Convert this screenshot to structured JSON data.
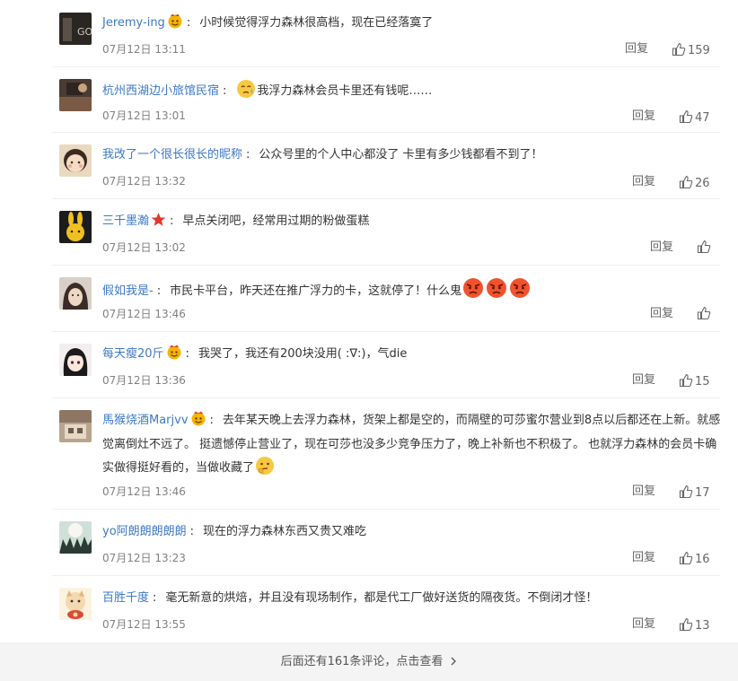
{
  "comments": [
    {
      "username": "Jeremy-ing",
      "text": "小时候觉得浮力森林很高档，现在已经落寞了",
      "date": "07月12日 13:11",
      "reply_label": "回复",
      "likes": "159",
      "badge": "crown-emoji-icon"
    },
    {
      "username": "杭州西湖边小旅馆民宿",
      "text": "我浮力森林会员卡里还有钱呢……",
      "date": "07月12日 13:01",
      "reply_label": "回复",
      "likes": "47",
      "lead_emoji": "crying-face-icon"
    },
    {
      "username": "我改了一个很长很长的昵称",
      "text": "公众号里的个人中心都没了 卡里有多少钱都看不到了！",
      "date": "07月12日 13:32",
      "reply_label": "回复",
      "likes": "26"
    },
    {
      "username": "三千墨瀚",
      "text": "早点关闭吧，经常用过期的粉做蛋糕",
      "date": "07月12日 13:02",
      "reply_label": "回复",
      "likes": "",
      "badge": "red-star-icon"
    },
    {
      "username": "假如我是-",
      "text": "市民卡平台，昨天还在推广浮力的卡，这就停了！什么鬼",
      "date": "07月12日 13:46",
      "reply_label": "回复",
      "likes": "",
      "trail_emoji": "angry-face-icon"
    },
    {
      "username": "每天瘦20斤",
      "text": "我哭了，我还有200块没用( :∇:)，气die",
      "date": "07月12日 13:36",
      "reply_label": "回复",
      "likes": "15",
      "badge": "crown-emoji-icon"
    },
    {
      "username": "馬猴烧酒Marjvv",
      "text": "去年某天晚上去浮力森林，货架上都是空的，而隔壁的可莎蜜尔营业到8点以后都还在上新。就感觉离倒灶不远了。 挺遗憾停止营业了，现在可莎也没多少竞争压力了，晚上补新也不积极了。 也就浮力森林的会员卡确实做得挺好看的，当做收藏了",
      "date": "07月12日 13:46",
      "reply_label": "回复",
      "likes": "17",
      "badge": "crown-emoji-icon",
      "trail_emoji": "thinking-face-icon"
    },
    {
      "username": "yo阿朗朗朗朗朗",
      "text": "现在的浮力森林东西又贵又难吃",
      "date": "07月12日 13:23",
      "reply_label": "回复",
      "likes": "16"
    },
    {
      "username": "百胜千度",
      "text": "毫无新意的烘焙，并且没有现场制作，都是代工厂做好送货的隔夜货。不倒闭才怪！",
      "date": "07月12日 13:55",
      "reply_label": "回复",
      "likes": "13"
    }
  ],
  "footer": {
    "more_label": "后面还有161条评论，点击查看",
    "more_icon": "chevron-right-icon"
  },
  "colors": {
    "username": "#3d78c5",
    "date": "#808080",
    "divider": "#eeeeee",
    "footer_bg": "#f4f4f4"
  }
}
